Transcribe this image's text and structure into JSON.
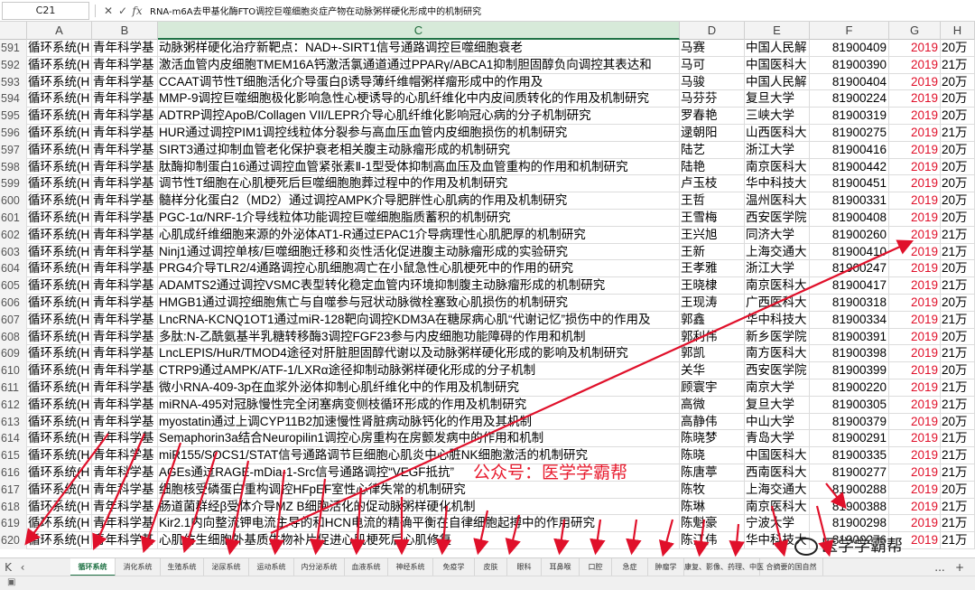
{
  "formula_bar": {
    "name_box": "C21",
    "fx_icon": "fx",
    "formula": "RNA-m6A去甲基化酶FTO调控巨噬细胞炎症产物在动脉粥样硬化形成中的机制研究"
  },
  "columns": [
    "A",
    "B",
    "C",
    "D",
    "E",
    "F",
    "G",
    "H"
  ],
  "selected_column": "C",
  "rows": [
    {
      "n": "591",
      "a": "循环系统(H",
      "b": "青年科学基",
      "c": "动脉粥样硬化治疗新靶点：NAD+-SIRT1信号通路调控巨噬细胞衰老",
      "d": "马赛",
      "e": "中国人民解",
      "f": "81900409",
      "g": "2019",
      "h": "20万"
    },
    {
      "n": "592",
      "a": "循环系统(H",
      "b": "青年科学基",
      "c": "激活血管内皮细胞TMEM16A钙激活氯通道通过PPARγ/ABCA1抑制胆固醇负向调控其表达和",
      "d": "马可",
      "e": "中国医科大",
      "f": "81900390",
      "g": "2019",
      "h": "21万"
    },
    {
      "n": "593",
      "a": "循环系统(H",
      "b": "青年科学基",
      "c": "CCAAT调节性T细胞活化介导蛋白β诱导薄纤维帽粥样瘤形成中的作用及",
      "d": "马骏",
      "e": "中国人民解",
      "f": "81900404",
      "g": "2019",
      "h": "20万"
    },
    {
      "n": "594",
      "a": "循环系统(H",
      "b": "青年科学基",
      "c": "MMP-9调控巨噬细胞极化影响急性心梗诱导的心肌纤维化中内皮间质转化的作用及机制研究",
      "d": "马芬芬",
      "e": "复旦大学",
      "f": "81900224",
      "g": "2019",
      "h": "20万"
    },
    {
      "n": "595",
      "a": "循环系统(H",
      "b": "青年科学基",
      "c": "ADTRP调控ApoB/Collagen VII/LEPR介导心肌纤维化影响冠心病的分子机制研究",
      "d": "罗春艳",
      "e": "三峡大学",
      "f": "81900319",
      "g": "2019",
      "h": "20万"
    },
    {
      "n": "596",
      "a": "循环系统(H",
      "b": "青年科学基",
      "c": "HUR通过调控PIM1调控线粒体分裂参与高血压血管内皮细胞损伤的机制研究",
      "d": "逯朝阳",
      "e": "山西医科大",
      "f": "81900275",
      "g": "2019",
      "h": "21万"
    },
    {
      "n": "597",
      "a": "循环系统(H",
      "b": "青年科学基",
      "c": "SIRT3通过抑制血管老化保护衰老相关腹主动脉瘤形成的机制研究",
      "d": "陆艺",
      "e": "浙江大学",
      "f": "81900416",
      "g": "2019",
      "h": "20万"
    },
    {
      "n": "598",
      "a": "循环系统(H",
      "b": "青年科学基",
      "c": "肽酶抑制蛋白16通过调控血管紧张素Ⅱ-1型受体抑制高血压及血管重构的作用和机制研究",
      "d": "陆艳",
      "e": "南京医科大",
      "f": "81900442",
      "g": "2019",
      "h": "20万"
    },
    {
      "n": "599",
      "a": "循环系统(H",
      "b": "青年科学基",
      "c": "调节性T细胞在心肌梗死后巨噬细胞胞葬过程中的作用及机制研究",
      "d": "卢玉枝",
      "e": "华中科技大",
      "f": "81900451",
      "g": "2019",
      "h": "20万"
    },
    {
      "n": "600",
      "a": "循环系统(H",
      "b": "青年科学基",
      "c": "髓样分化蛋白2（MD2）通过调控AMPK介导肥胖性心肌病的作用及机制研究",
      "d": "王哲",
      "e": "温州医科大",
      "f": "81900331",
      "g": "2019",
      "h": "20万"
    },
    {
      "n": "601",
      "a": "循环系统(H",
      "b": "青年科学基",
      "c": "PGC-1α/NRF-1介导线粒体功能调控巨噬细胞脂质蓄积的机制研究",
      "d": "王雪梅",
      "e": "西安医学院",
      "f": "81900408",
      "g": "2019",
      "h": "20万"
    },
    {
      "n": "602",
      "a": "循环系统(H",
      "b": "青年科学基",
      "c": "心肌成纤维细胞来源的外泌体AT1-R通过EPAC1介导病理性心肌肥厚的机制研究",
      "d": "王兴旭",
      "e": "同济大学",
      "f": "81900260",
      "g": "2019",
      "h": "21万"
    },
    {
      "n": "603",
      "a": "循环系统(H",
      "b": "青年科学基",
      "c": "Ninj1通过调控单核/巨噬细胞迁移和炎性活化促进腹主动脉瘤形成的实验研究",
      "d": "王新",
      "e": "上海交通大",
      "f": "81900410",
      "g": "2019",
      "h": "21万"
    },
    {
      "n": "604",
      "a": "循环系统(H",
      "b": "青年科学基",
      "c": "PRG4介导TLR2/4通路调控心肌细胞凋亡在小鼠急性心肌梗死中的作用的研究",
      "d": "王孝雅",
      "e": "浙江大学",
      "f": "81900247",
      "g": "2019",
      "h": "20万"
    },
    {
      "n": "605",
      "a": "循环系统(H",
      "b": "青年科学基",
      "c": "ADAMTS2通过调控VSMC表型转化稳定血管内环境抑制腹主动脉瘤形成的机制研究",
      "d": "王晓棣",
      "e": "南京医科大",
      "f": "81900417",
      "g": "2019",
      "h": "21万"
    },
    {
      "n": "606",
      "a": "循环系统(H",
      "b": "青年科学基",
      "c": "HMGB1通过调控细胞焦亡与自噬参与冠状动脉微栓塞致心肌损伤的机制研究",
      "d": "王现涛",
      "e": "广西医科大",
      "f": "81900318",
      "g": "2019",
      "h": "20万"
    },
    {
      "n": "607",
      "a": "循环系统(H",
      "b": "青年科学基",
      "c": "LncRNA-KCNQ1OT1通过miR-128靶向调控KDM3A在糖尿病心肌“代谢记忆”损伤中的作用及",
      "d": "郭鑫",
      "e": "华中科技大",
      "f": "81900334",
      "g": "2019",
      "h": "21万"
    },
    {
      "n": "608",
      "a": "循环系统(H",
      "b": "青年科学基",
      "c": "多肽:N-乙酰氨基半乳糖转移酶3调控FGF23参与内皮细胞功能障碍的作用和机制",
      "d": "郭利伟",
      "e": "新乡医学院",
      "f": "81900391",
      "g": "2019",
      "h": "20万"
    },
    {
      "n": "609",
      "a": "循环系统(H",
      "b": "青年科学基",
      "c": "LncLEPIS/HuR/TMOD4途径对肝脏胆固醇代谢以及动脉粥样硬化形成的影响及机制研究",
      "d": "郭凯",
      "e": "南方医科大",
      "f": "81900398",
      "g": "2019",
      "h": "21万"
    },
    {
      "n": "610",
      "a": "循环系统(H",
      "b": "青年科学基",
      "c": "CTRP9通过AMPK/ATF-1/LXRα途径抑制动脉粥样硬化形成的分子机制",
      "d": "关华",
      "e": "西安医学院",
      "f": "81900399",
      "g": "2019",
      "h": "20万"
    },
    {
      "n": "611",
      "a": "循环系统(H",
      "b": "青年科学基",
      "c": "微小RNA-409-3p在血浆外泌体抑制心肌纤维化中的作用及机制研究",
      "d": "顾寰宇",
      "e": "南京大学",
      "f": "81900220",
      "g": "2019",
      "h": "21万"
    },
    {
      "n": "612",
      "a": "循环系统(H",
      "b": "青年科学基",
      "c": "miRNA-495对冠脉慢性完全闭塞病变侧枝循环形成的作用及机制研究",
      "d": "高微",
      "e": "复旦大学",
      "f": "81900305",
      "g": "2019",
      "h": "21万"
    },
    {
      "n": "613",
      "a": "循环系统(H",
      "b": "青年科学基",
      "c": "myostatin通过上调CYP11B2加速慢性肾脏病动脉钙化的作用及其机制",
      "d": "高静伟",
      "e": "中山大学",
      "f": "81900379",
      "g": "2019",
      "h": "20万"
    },
    {
      "n": "614",
      "a": "循环系统(H",
      "b": "青年科学基",
      "c": "Semaphorin3a结合Neuropilin1调控心房重构在房颤发病中的作用和机制",
      "d": "陈晓梦",
      "e": "青岛大学",
      "f": "81900291",
      "g": "2019",
      "h": "21万"
    },
    {
      "n": "615",
      "a": "循环系统(H",
      "b": "青年科学基",
      "c": "miR155/SOCS1/STAT信号通路调节巨细胞心肌炎中心脏NK细胞激活的机制研究",
      "d": "陈晓",
      "e": "中国医科大",
      "f": "81900335",
      "g": "2019",
      "h": "21万"
    },
    {
      "n": "616",
      "a": "循环系统(H",
      "b": "青年科学基",
      "c": "AGEs通过RAGE-mDia-1-Src信号通路调控“VEGF抵抗”",
      "d": "陈唐葶",
      "e": "西南医科大",
      "f": "81900277",
      "g": "2019",
      "h": "21万"
    },
    {
      "n": "617",
      "a": "循环系统(H",
      "b": "青年科学基",
      "c": "细胞核受磷蛋白重构调控HFpEF室性心律失常的机制研究",
      "d": "陈牧",
      "e": "上海交通大",
      "f": "81900288",
      "g": "2019",
      "h": "20万"
    },
    {
      "n": "618",
      "a": "循环系统(H",
      "b": "青年科学基",
      "c": "肠道菌群经β受体介导MZ B细胞活化的促动脉粥样硬化机制",
      "d": "陈琳",
      "e": "南京医科大",
      "f": "81900388",
      "g": "2019",
      "h": "21万"
    },
    {
      "n": "619",
      "a": "循环系统(H",
      "b": "青年科学基",
      "c": "Kir2.1内向整流钾电流主导的和HCN电流的精确平衡在自律细胞起搏中的作用研究",
      "d": "陈魁豪",
      "e": "宁波大学",
      "f": "81900298",
      "g": "2019",
      "h": "21万"
    },
    {
      "n": "620",
      "a": "循环系统(H",
      "b": "青年科学基",
      "c": "心肌仿生细胞外基质生物补片促进心肌梗死后心肌修复",
      "d": "陈江伟",
      "e": "华中科技大",
      "f": "81900276",
      "g": "2019",
      "h": "21万"
    }
  ],
  "sheet_tabs": [
    {
      "label": "循环系统",
      "active": true
    },
    {
      "label": "消化系统",
      "active": false
    },
    {
      "label": "生殖系统",
      "active": false
    },
    {
      "label": "泌尿系统",
      "active": false
    },
    {
      "label": "运动系统",
      "active": false
    },
    {
      "label": "内分泌系统",
      "active": false
    },
    {
      "label": "血液系统",
      "active": false
    },
    {
      "label": "神经系统",
      "active": false
    },
    {
      "label": "免疫学",
      "active": false
    },
    {
      "label": "皮肤",
      "active": false
    },
    {
      "label": "眼科",
      "active": false
    },
    {
      "label": "耳鼻喉",
      "active": false
    },
    {
      "label": "口腔",
      "active": false
    },
    {
      "label": "急症",
      "active": false
    },
    {
      "label": "肿瘤学",
      "active": false
    },
    {
      "label": "康复、影像、药理、中医",
      "active": false
    },
    {
      "label": "合摘要的国自然",
      "active": false
    }
  ],
  "tab_more_label": "...",
  "tab_add_label": "+",
  "overlay": {
    "watermark": "公众号：医学学霸帮",
    "logo_text": "医学学霸帮",
    "annotation_color": "#e0102a"
  }
}
